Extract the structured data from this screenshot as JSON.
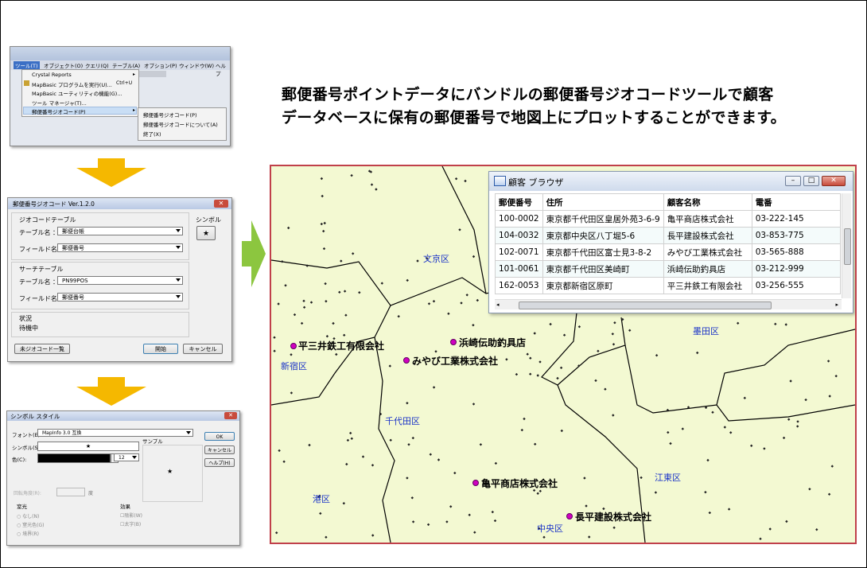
{
  "headline": {
    "line1": "郵便番号ポイントデータにバンドルの郵便番号ジオコードツールで顧客",
    "line2": "データベースに保有の郵便番号で地図上にプロットすることができます。"
  },
  "colors": {
    "arrow_down": "#f5b800",
    "arrow_right": "#8cc63f",
    "pin": "#d000c0",
    "map_bg": "#f3f9d2",
    "map_border": "#c0404a",
    "ward_label": "#1a33c8"
  },
  "tools_menu": {
    "menubar": [
      "ツール(T)",
      "オブジェクト(O)",
      "クエリ(Q)",
      "テーブル(A)",
      "オプション(P)",
      "ウィンドウ(W)",
      "ヘルプ"
    ],
    "items": [
      "Crystal Reports",
      "MapBasic プログラムを実行(U)...",
      "MapBasic ユーティリティの機能(G)...",
      "ツール マネージャ(T)...",
      "郵便番号ジオコード(P)"
    ],
    "run_shortcut": "Ctrl+U",
    "submenu": [
      "郵便番号ジオコード(P)",
      "郵便番号ジオコードについて(A)",
      "終了(X)"
    ]
  },
  "geocode_dialog": {
    "title": "郵便番号ジオコード Ver.1.2.0",
    "geocode_table_group": "ジオコードテーブル",
    "table_label": "テーブル名 ：",
    "field_label": "フィールド名 ：",
    "geocode_table_value": "郵便台帳",
    "geocode_field_value": "郵便番号",
    "search_table_group": "サーチテーブル",
    "search_table_value": "PN99POS",
    "search_field_value": "郵便番号",
    "symbol_label": "シンボル",
    "symbol_glyph": "★",
    "status_label": "状況",
    "status_value": "待機中",
    "btn_list": "未ジオコード一覧",
    "btn_start": "開始",
    "btn_cancel": "キャンセル"
  },
  "symbol_dialog": {
    "title": "シンボル スタイル",
    "font_label": "フォント(E):",
    "font_value": "MapInfo 3.0 互換",
    "symbol_label": "シンボル(S):",
    "symbol_glyph": "★",
    "color_label": "色(C):",
    "size_value": "12",
    "sample_label": "サンプル",
    "rotation_label": "回転角度(R):",
    "rotation_unit": "度",
    "halo_group": "窒光",
    "halo_options": [
      "なし(N)",
      "窒光色(G)",
      "境界(R)"
    ],
    "effect_group": "効果",
    "effect_options": [
      "陰影(W)",
      "太字(B)"
    ],
    "btn_ok": "OK",
    "btn_cancel": "キャンセル",
    "btn_help": "ヘルプ(H)"
  },
  "map": {
    "wards": [
      "文京区",
      "墨田区",
      "新宿区",
      "千代田区",
      "江東区",
      "港区",
      "中央区"
    ],
    "points": [
      "平三井鉄工有限会社",
      "浜崎伝助釣具店",
      "みやび工業株式会社",
      "亀平商店株式会社",
      "長平建設株式会社"
    ]
  },
  "browser": {
    "title": "顧客 ブラウザ",
    "columns": [
      "郵便番号",
      "住所",
      "顧客名称",
      "電番"
    ],
    "rows": [
      [
        "100-0002",
        "東京都千代田区皇居外苑3-6-9",
        "亀平商店株式会社",
        "03-222-145"
      ],
      [
        "104-0032",
        "東京都中央区八丁堀5-6",
        "長平建設株式会社",
        "03-853-775"
      ],
      [
        "102-0071",
        "東京都千代田区富士見3-8-2",
        "みやび工業株式会社",
        "03-565-888"
      ],
      [
        "101-0061",
        "東京都千代田区美崎町",
        "浜崎伝助釣具店",
        "03-212-999"
      ],
      [
        "162-0053",
        "東京都新宿区原町",
        "平三井鉄工有限会社",
        "03-256-555"
      ]
    ]
  }
}
